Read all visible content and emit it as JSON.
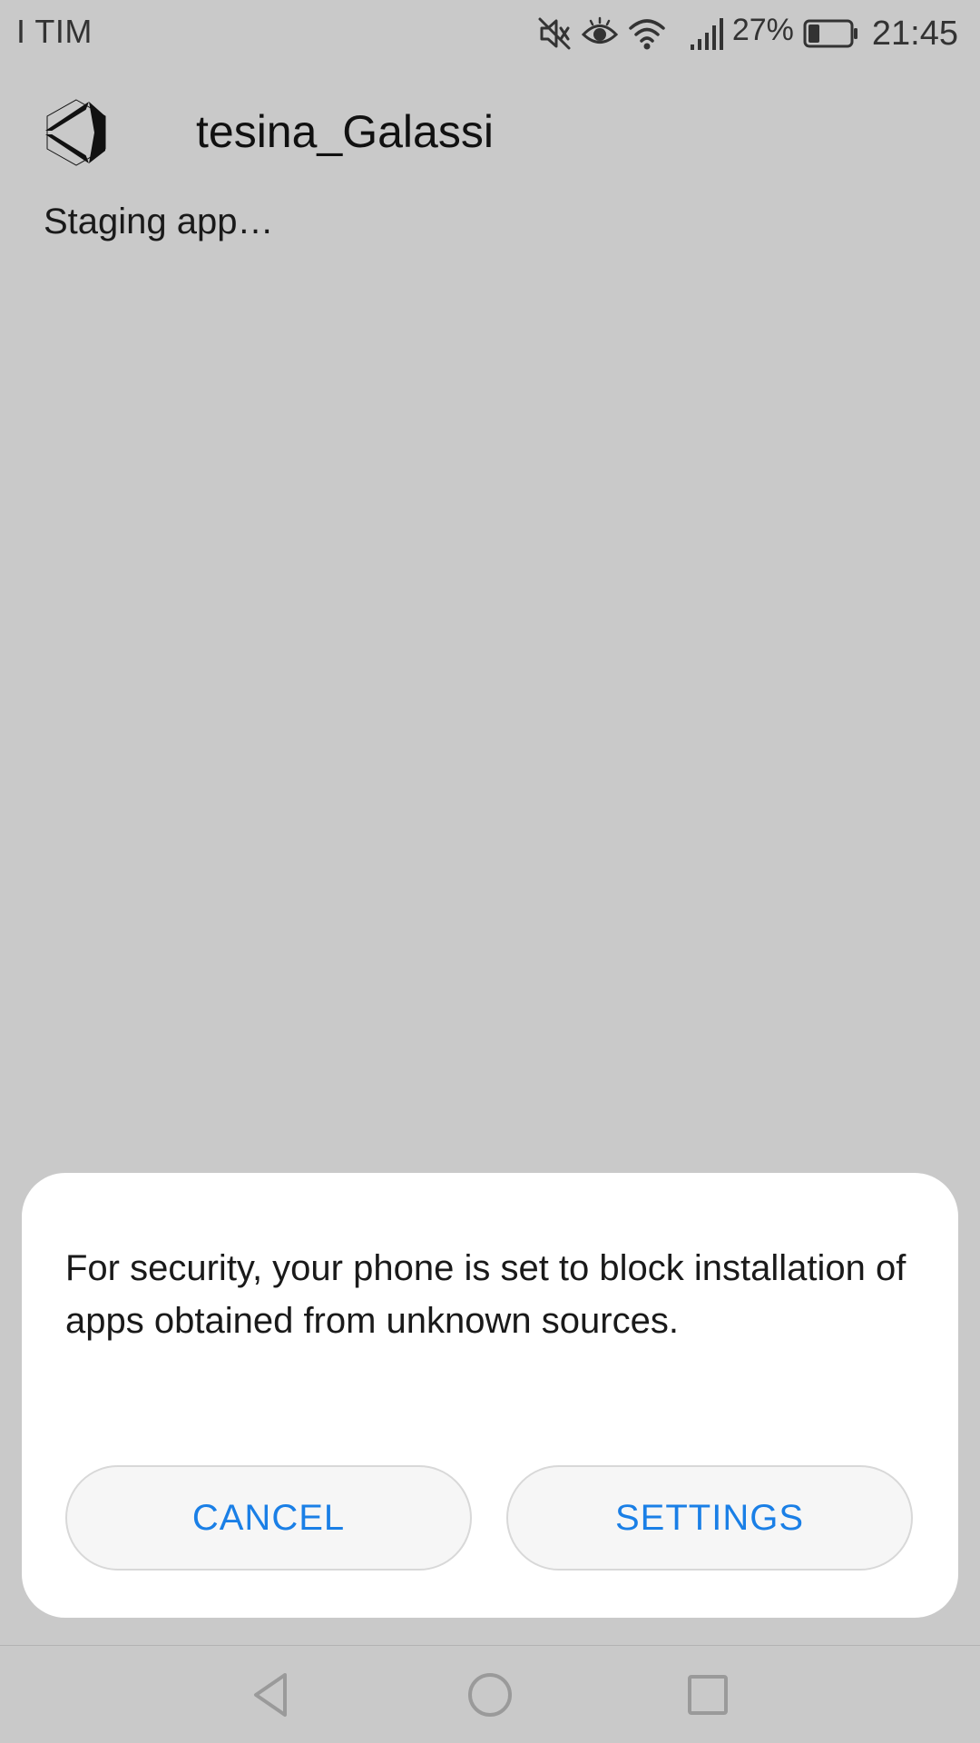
{
  "status_bar": {
    "carrier": "I TIM",
    "battery_percent": "27%",
    "time": "21:45",
    "icons": [
      "mute-icon",
      "eye-icon",
      "wifi-icon",
      "signal-icon",
      "battery-icon"
    ],
    "battery_level": 0.27
  },
  "app": {
    "icon": "unity-logo-icon",
    "title": "tesina_Galassi",
    "status_text": "Staging app…"
  },
  "dialog": {
    "message": "For security, your phone is set to block installation of apps obtained from unknown sources.",
    "cancel_label": "CANCEL",
    "settings_label": "SETTINGS"
  },
  "nav_bar": {
    "icons": [
      "back-icon",
      "home-icon",
      "recents-icon"
    ]
  },
  "colors": {
    "background": "#c9c9c9",
    "dialog_background": "#ffffff",
    "button_text": "#1a7fe6",
    "button_background": "#f6f6f6"
  }
}
